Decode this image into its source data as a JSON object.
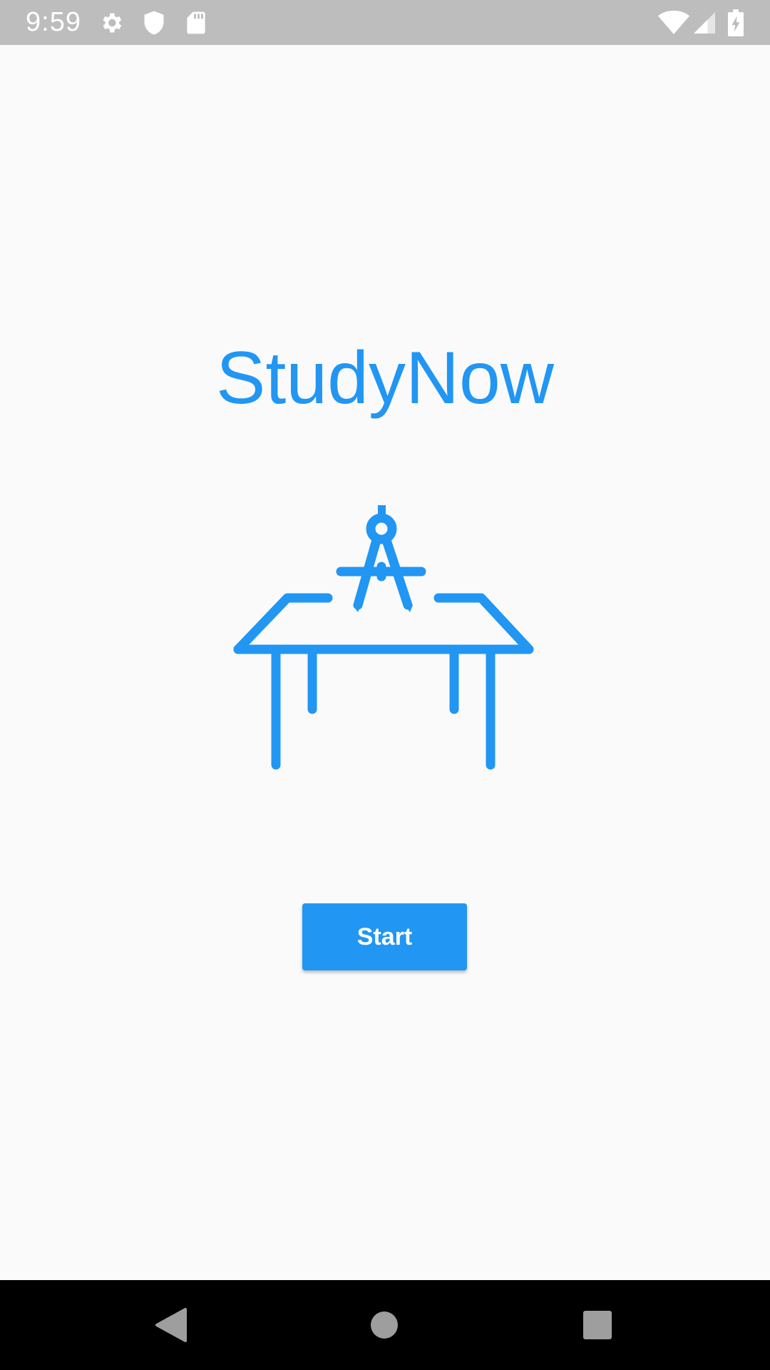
{
  "status_bar": {
    "time": "9:59",
    "icons": [
      "gear-icon",
      "shield-icon",
      "sd-card-icon",
      "wifi-icon",
      "signal-icon",
      "battery-charging-icon"
    ]
  },
  "main": {
    "title": "StudyNow",
    "illustration": "desk-with-compass-icon",
    "start_button_label": "Start"
  },
  "nav_bar": {
    "buttons": [
      "back-icon",
      "home-icon",
      "recents-icon"
    ]
  },
  "colors": {
    "accent": "#2196f3",
    "background": "#fafafa",
    "status_bar": "#bdbdbd",
    "nav_bar": "#000000"
  }
}
